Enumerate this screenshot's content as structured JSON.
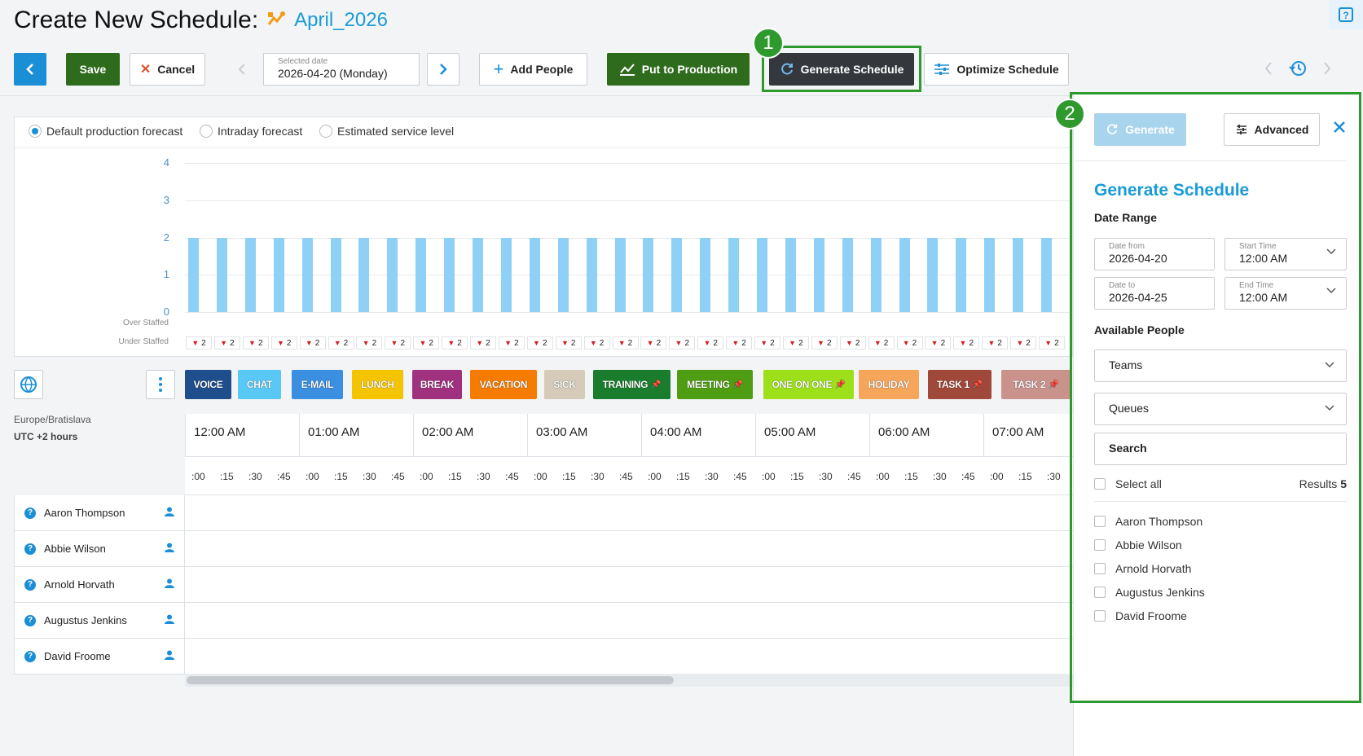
{
  "header": {
    "title": "Create New Schedule:",
    "schedule_name": "April_2026"
  },
  "toolbar": {
    "save": "Save",
    "cancel": "Cancel",
    "selected_date_label": "Selected date",
    "selected_date_value": "2026-04-20 (Monday)",
    "add_people": "Add People",
    "put_to_production": "Put to Production",
    "generate_schedule": "Generate Schedule",
    "optimize_schedule": "Optimize Schedule"
  },
  "callouts": [
    "1",
    "2"
  ],
  "forecast_options": [
    {
      "label": "Default production forecast",
      "selected": true
    },
    {
      "label": "Intraday forecast",
      "selected": false
    },
    {
      "label": "Estimated service level",
      "selected": false
    }
  ],
  "chart_data": {
    "type": "bar",
    "y_ticks": [
      "4",
      "3",
      "2",
      "1",
      "0"
    ],
    "ylim": [
      0,
      4
    ],
    "values": [
      2,
      2,
      2,
      2,
      2,
      2,
      2,
      2,
      2,
      2,
      2,
      2,
      2,
      2,
      2,
      2,
      2,
      2,
      2,
      2,
      2,
      2,
      2,
      2,
      2,
      2,
      2,
      2,
      2,
      2,
      2
    ],
    "bar_color": "#8fd0f7",
    "over_staffed_label": "Over Staffed",
    "under_staffed_label": "Under Staffed",
    "under_staffed_values": [
      "2",
      "2",
      "2",
      "2",
      "2",
      "2",
      "2",
      "2",
      "2",
      "2",
      "2",
      "2",
      "2",
      "2",
      "2",
      "2",
      "2",
      "2",
      "2",
      "2",
      "2",
      "2",
      "2",
      "2",
      "2",
      "2",
      "2",
      "2",
      "2",
      "2",
      "2"
    ]
  },
  "activity_types": [
    {
      "label": "VOICE",
      "color": "#1f4e8c"
    },
    {
      "label": "CHAT",
      "color": "#5ac8f5"
    },
    {
      "label": "E-MAIL",
      "color": "#3a8fe0"
    },
    {
      "label": "LUNCH",
      "color": "#f5c400"
    },
    {
      "label": "BREAK",
      "color": "#a0317e"
    },
    {
      "label": "VACATION",
      "color": "#f57c00"
    },
    {
      "label": "SICK",
      "color": "#d6cbb8"
    },
    {
      "label": "TRAINING",
      "color": "#1a7d2e"
    },
    {
      "label": "MEETING",
      "color": "#4f9d12"
    },
    {
      "label": "ONE ON ONE",
      "color": "#9de01a"
    },
    {
      "label": "HOLIDAY",
      "color": "#f5a65b"
    },
    {
      "label": "TASK 1",
      "color": "#a0483a"
    },
    {
      "label": "TASK 2",
      "color": "#c9938c"
    }
  ],
  "timezone": {
    "name": "Europe/Bratislava",
    "offset": "UTC +2 hours"
  },
  "hours": [
    "12:00 AM",
    "01:00 AM",
    "02:00 AM",
    "03:00 AM",
    "04:00 AM",
    "05:00 AM",
    "06:00 AM",
    "07:00 AM"
  ],
  "quarters": [
    ":00",
    ":15",
    ":30",
    ":45"
  ],
  "people": [
    "Aaron Thompson",
    "Abbie Wilson",
    "Arnold Horvath",
    "Augustus Jenkins",
    "David Froome"
  ],
  "generate_panel": {
    "generate_button": "Generate",
    "advanced_button": "Advanced",
    "title": "Generate Schedule",
    "date_range_label": "Date Range",
    "date_from_label": "Date from",
    "date_from": "2026-04-20",
    "start_time_label": "Start Time",
    "start_time": "12:00 AM",
    "date_to_label": "Date to",
    "date_to": "2026-04-25",
    "end_time_label": "End Time",
    "end_time": "12:00 AM",
    "available_people_label": "Available People",
    "teams_label": "Teams",
    "queues_label": "Queues",
    "search_placeholder": "Search",
    "select_all": "Select all",
    "results_label": "Results",
    "results_count": "5"
  }
}
